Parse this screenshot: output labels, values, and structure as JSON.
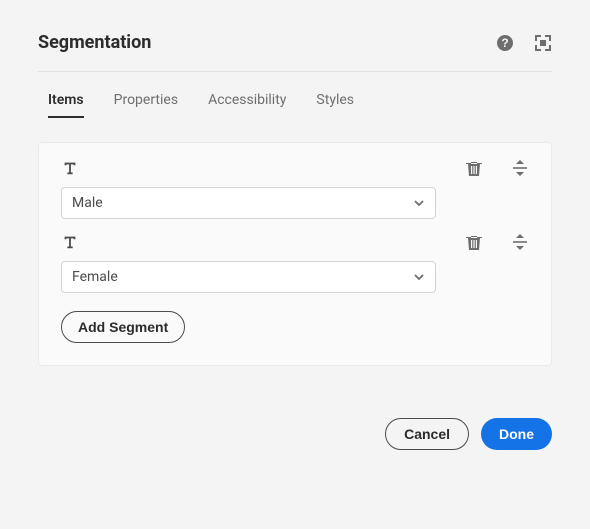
{
  "header": {
    "title": "Segmentation",
    "icons": {
      "help": "help-icon",
      "expand": "fullscreen-icon"
    }
  },
  "tabs": [
    {
      "label": "Items",
      "active": true
    },
    {
      "label": "Properties",
      "active": false
    },
    {
      "label": "Accessibility",
      "active": false
    },
    {
      "label": "Styles",
      "active": false
    }
  ],
  "items": [
    {
      "value": "Male"
    },
    {
      "value": "Female"
    }
  ],
  "buttons": {
    "add": "Add Segment",
    "cancel": "Cancel",
    "done": "Done"
  }
}
